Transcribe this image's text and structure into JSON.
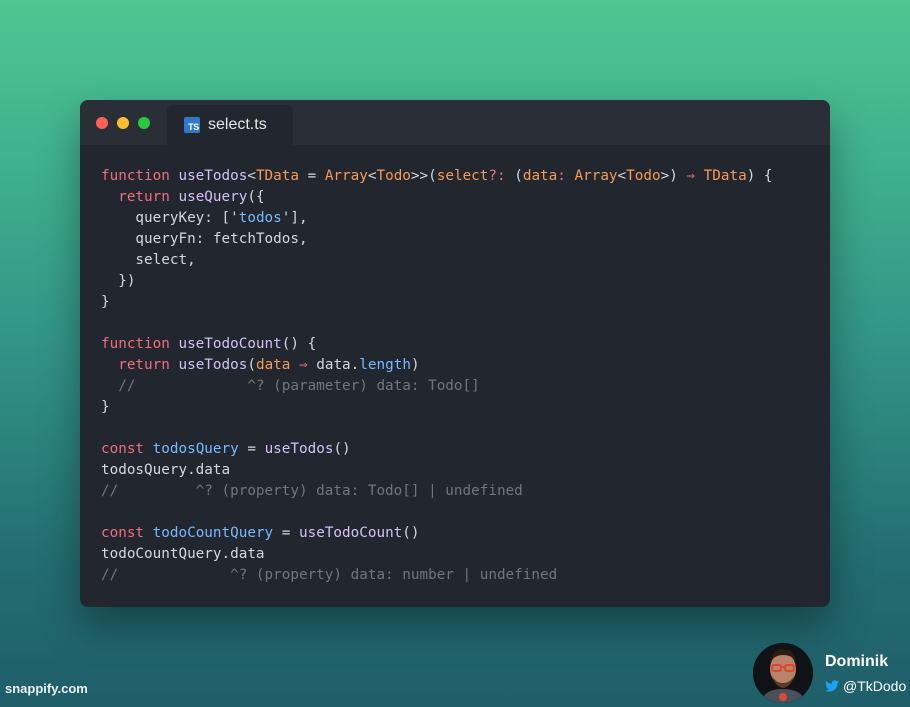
{
  "window": {
    "file_tab": {
      "icon": "typescript-file-icon",
      "icon_text": "TS",
      "label": "select.ts"
    },
    "traffic_lights": {
      "close_color": "#fe5f57",
      "minimize_color": "#febc2e",
      "maximize_color": "#28c840"
    }
  },
  "code": {
    "lines": [
      [
        [
          "keyword",
          "function "
        ],
        [
          "func",
          "useTodos"
        ],
        [
          "plain",
          "<"
        ],
        [
          "type",
          "TData"
        ],
        [
          "plain",
          " = "
        ],
        [
          "type",
          "Array"
        ],
        [
          "plain",
          "<"
        ],
        [
          "type",
          "Todo"
        ],
        [
          "plain",
          ">>("
        ],
        [
          "param",
          "select"
        ],
        [
          "op",
          "?:"
        ],
        [
          "plain",
          " ("
        ],
        [
          "param",
          "data"
        ],
        [
          "op",
          ":"
        ],
        [
          "plain",
          " "
        ],
        [
          "type",
          "Array"
        ],
        [
          "plain",
          "<"
        ],
        [
          "type",
          "Todo"
        ],
        [
          "plain",
          ">) "
        ],
        [
          "op",
          "⇒"
        ],
        [
          "plain",
          " "
        ],
        [
          "type",
          "TData"
        ],
        [
          "plain",
          ") {"
        ]
      ],
      [
        [
          "plain",
          "  "
        ],
        [
          "keyword",
          "return "
        ],
        [
          "func",
          "useQuery"
        ],
        [
          "plain",
          "({"
        ]
      ],
      [
        [
          "plain",
          "    queryKey: ['"
        ],
        [
          "string",
          "todos"
        ],
        [
          "plain",
          "'],"
        ]
      ],
      [
        [
          "plain",
          "    queryFn: fetchTodos,"
        ]
      ],
      [
        [
          "plain",
          "    select,"
        ]
      ],
      [
        [
          "plain",
          "  })"
        ]
      ],
      [
        [
          "plain",
          "}"
        ]
      ],
      [
        [
          "plain",
          ""
        ]
      ],
      [
        [
          "keyword",
          "function "
        ],
        [
          "func",
          "useTodoCount"
        ],
        [
          "plain",
          "() {"
        ]
      ],
      [
        [
          "plain",
          "  "
        ],
        [
          "keyword",
          "return "
        ],
        [
          "func",
          "useTodos"
        ],
        [
          "plain",
          "("
        ],
        [
          "param",
          "data"
        ],
        [
          "plain",
          " "
        ],
        [
          "op",
          "⇒"
        ],
        [
          "plain",
          " data."
        ],
        [
          "prop",
          "length"
        ],
        [
          "plain",
          ")"
        ]
      ],
      [
        [
          "comment",
          "  //             ^? (parameter) data: Todo[]"
        ]
      ],
      [
        [
          "plain",
          "}"
        ]
      ],
      [
        [
          "plain",
          ""
        ]
      ],
      [
        [
          "keyword",
          "const "
        ],
        [
          "var",
          "todosQuery"
        ],
        [
          "plain",
          " = "
        ],
        [
          "func",
          "useTodos"
        ],
        [
          "plain",
          "()"
        ]
      ],
      [
        [
          "plain",
          "todosQuery.data"
        ]
      ],
      [
        [
          "comment",
          "//         ^? (property) data: Todo[] | undefined"
        ]
      ],
      [
        [
          "plain",
          ""
        ]
      ],
      [
        [
          "keyword",
          "const "
        ],
        [
          "var",
          "todoCountQuery"
        ],
        [
          "plain",
          " = "
        ],
        [
          "func",
          "useTodoCount"
        ],
        [
          "plain",
          "()"
        ]
      ],
      [
        [
          "plain",
          "todoCountQuery.data"
        ]
      ],
      [
        [
          "comment",
          "//             ^? (property) data: number | undefined"
        ]
      ]
    ]
  },
  "footer": {
    "watermark": "snappify.com",
    "author": {
      "avatar": "avatar-photo",
      "name": "Dominik",
      "handle_icon": "twitter-bird-icon",
      "handle": "@TkDodo"
    }
  },
  "colors": {
    "background_top": "#4fc691",
    "background_bottom": "#1f5e6a",
    "editor_bg": "#22262e",
    "titlebar_bg": "#2a2e36",
    "keyword": "#ee6f7b",
    "function": "#d5c0f5",
    "type": "#f59a5a",
    "string": "#79b8ff",
    "comment": "#6e7681",
    "twitter_blue": "#1da1f2"
  }
}
